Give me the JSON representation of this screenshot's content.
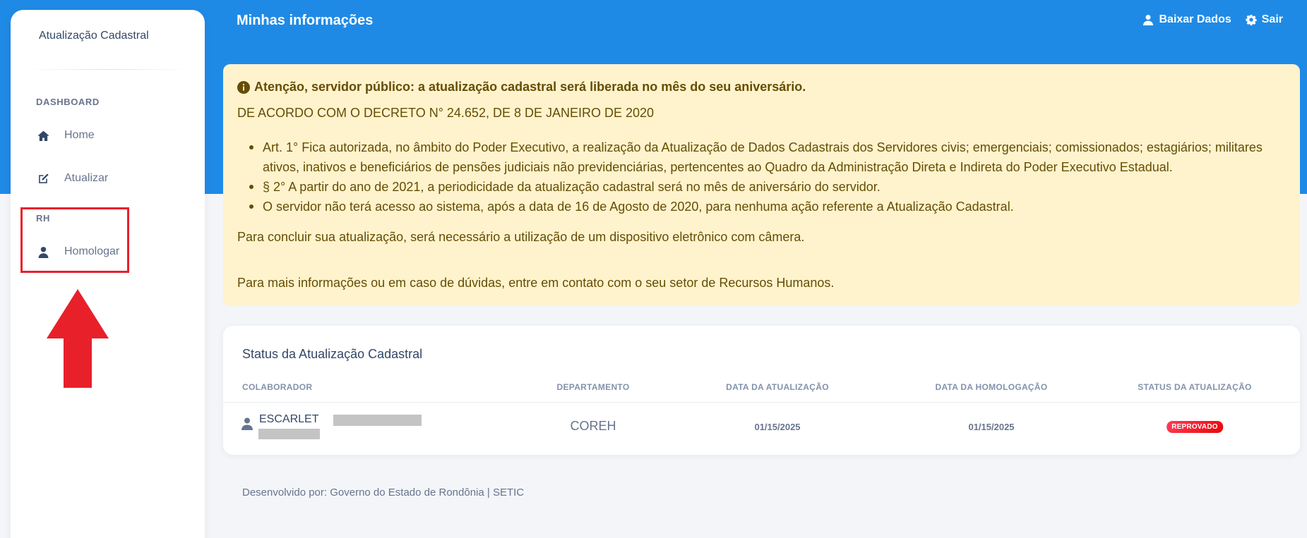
{
  "header": {
    "title": "Minhas informações",
    "actions": [
      {
        "label": "Baixar Dados",
        "icon": "user-icon"
      },
      {
        "label": "Sair",
        "icon": "gear-icon"
      }
    ]
  },
  "sidebar": {
    "brand": "Atualização Cadastral",
    "sections": [
      {
        "label": "DASHBOARD",
        "items": [
          {
            "label": "Home",
            "icon": "home-icon"
          },
          {
            "label": "Atualizar",
            "icon": "edit-icon"
          }
        ]
      },
      {
        "label": "RH",
        "items": [
          {
            "label": "Homologar",
            "icon": "user-icon"
          }
        ]
      }
    ]
  },
  "alert": {
    "title": "Atenção, servidor público: a atualização cadastral será liberada no mês do seu aniversário.",
    "subtitle": "DE ACORDO COM O DECRETO N° 24.652, DE 8 DE JANEIRO DE 2020",
    "items": [
      "Art. 1° Fica autorizada, no âmbito do Poder Executivo, a realização da Atualização de Dados Cadastrais dos Servidores civis; emergenciais; comissionados; estagiários; militares ativos, inativos e beneficiários de pensões judiciais não previdenciárias, pertencentes ao Quadro da Administração Direta e Indireta do Poder Executivo Estadual.",
      "§ 2° A partir do ano de 2021, a periodicidade da atualização cadastral será no mês de aniversário do servidor.",
      "O servidor não terá acesso ao sistema, após a data de 16 de Agosto de 2020, para nenhuma ação referente a Atualização Cadastral."
    ],
    "paragraph1": "Para concluir sua atualização, será necessário a utilização de um dispositivo eletrônico com câmera.",
    "paragraph2": "Para mais informações ou em caso de dúvidas, entre em contato com o seu setor de Recursos Humanos."
  },
  "status_card": {
    "title": "Status da Atualização Cadastral",
    "columns": [
      "COLABORADOR",
      "DEPARTAMENTO",
      "DATA DA ATUALIZAÇÃO",
      "DATA DA HOMOLOGAÇÃO",
      "STATUS DA ATUALIZAÇÃO"
    ],
    "rows": [
      {
        "colaborador": "ESCARLET",
        "departamento": "COREH",
        "data_atualizacao": "01/15/2025",
        "data_homologacao": "01/15/2025",
        "status": "REPROVADO"
      }
    ]
  },
  "footer": {
    "text": "Desenvolvido por: Governo do Estado de Rondônia | SETIC"
  },
  "colors": {
    "header_blue": "#1f8ae6",
    "alert_bg": "#fff3cd",
    "alert_text": "#664d03",
    "badge_red": "#ea0606",
    "annotation_red": "#e8202a"
  }
}
